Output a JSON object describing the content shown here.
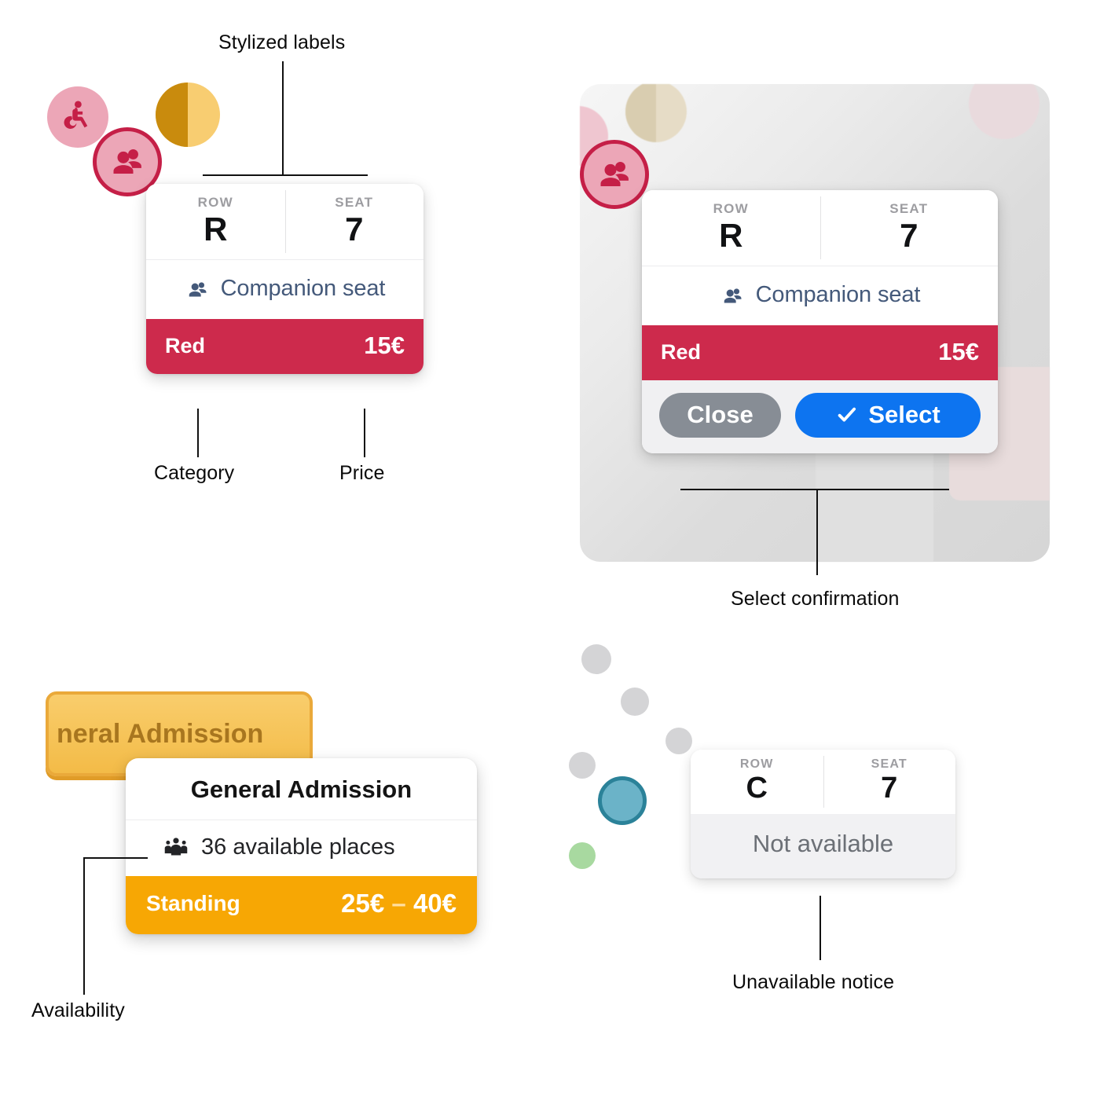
{
  "annotations": {
    "stylized_labels": "Stylized labels",
    "category": "Category",
    "price": "Price",
    "select_confirmation": "Select confirmation",
    "availability": "Availability",
    "unavailable_notice": "Unavailable notice"
  },
  "colors": {
    "red_category": "#cd2a4c",
    "orange_standing": "#f7a704",
    "blue_select": "#0d74f0",
    "gray_close": "#878d95",
    "companion_text": "#44597a",
    "ga_block_fill": "#f6c65c",
    "ga_block_border": "#eaa93a",
    "ga_block_text": "#a8761f",
    "teal_seat": "#6bb3c8",
    "teal_seat_border": "#2b8299",
    "green_seat": "#a8d9a0",
    "pink_seat": "#e9a3b5",
    "accessibility_badge": "#e8a0b2",
    "accessibility_icon": "#c51f47"
  },
  "tooltip_seat_selected": {
    "row_label": "ROW",
    "row_value": "R",
    "seat_label": "SEAT",
    "seat_value": "7",
    "note_icon": "companion-seat-icon",
    "note": "Companion seat",
    "category": "Red",
    "price": "15€"
  },
  "tooltip_seat_confirm": {
    "row_label": "ROW",
    "row_value": "R",
    "seat_label": "SEAT",
    "seat_value": "7",
    "note_icon": "companion-seat-icon",
    "note": "Companion seat",
    "category": "Red",
    "price": "15€",
    "close_label": "Close",
    "select_label": "Select",
    "select_icon": "check-icon"
  },
  "tooltip_general_admission": {
    "title": "General Admission",
    "availability_icon": "people-group-icon",
    "availability": "36 available places",
    "category": "Standing",
    "price_min": "25€",
    "price_dash": "–",
    "price_max": "40€"
  },
  "tooltip_unavailable": {
    "row_label": "ROW",
    "row_value": "C",
    "seat_label": "SEAT",
    "seat_value": "7",
    "status": "Not available"
  },
  "map_decor": {
    "ga_block_label": "neral Admission",
    "wheelchair_icon": "wheelchair-icon",
    "companion_badge_icon": "companion-seat-badge-icon"
  }
}
